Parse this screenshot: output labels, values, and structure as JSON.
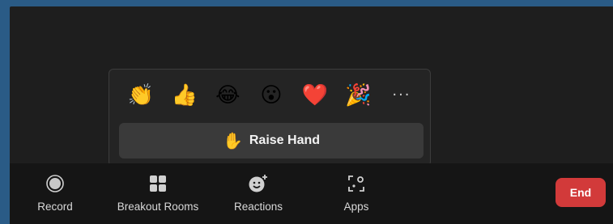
{
  "reactions": {
    "emojis": [
      {
        "name": "clapping-hands",
        "glyph": "👏"
      },
      {
        "name": "thumbs-up",
        "glyph": "👍"
      },
      {
        "name": "tears-of-joy",
        "glyph": "😂"
      },
      {
        "name": "open-mouth",
        "glyph": "😮"
      },
      {
        "name": "heart",
        "glyph": "❤️"
      },
      {
        "name": "party-popper",
        "glyph": "🎉"
      }
    ],
    "more_label": "···",
    "raise_hand_icon": "✋",
    "raise_hand_label": "Raise Hand"
  },
  "toolbar": {
    "record_label": "Record",
    "breakout_label": "Breakout Rooms",
    "reactions_label": "Reactions",
    "apps_label": "Apps",
    "end_label": "End"
  },
  "colors": {
    "end_button": "#d23a3a",
    "toolbar_bg": "#151515",
    "window_bg": "#1e1e1e"
  }
}
